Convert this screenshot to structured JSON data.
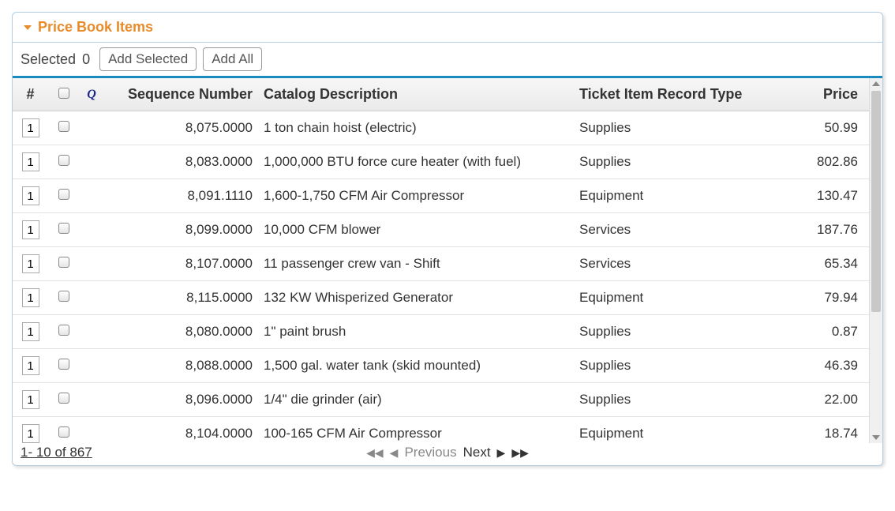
{
  "panel": {
    "title": "Price Book Items"
  },
  "toolbar": {
    "selected_label": "Selected",
    "selected_count": "0",
    "add_selected_label": "Add Selected",
    "add_all_label": "Add All"
  },
  "columns": {
    "num": "#",
    "q": "Q",
    "sequence": "Sequence Number",
    "description": "Catalog Description",
    "record_type": "Ticket Item Record Type",
    "price": "Price"
  },
  "rows": [
    {
      "qty": "1",
      "sequence": "8,075.0000",
      "description": "1 ton chain hoist (electric)",
      "record_type": "Supplies",
      "price": "50.99"
    },
    {
      "qty": "1",
      "sequence": "8,083.0000",
      "description": "1,000,000 BTU force cure heater (with fuel)",
      "record_type": "Supplies",
      "price": "802.86"
    },
    {
      "qty": "1",
      "sequence": "8,091.1110",
      "description": "1,600-1,750 CFM Air Compressor",
      "record_type": "Equipment",
      "price": "130.47"
    },
    {
      "qty": "1",
      "sequence": "8,099.0000",
      "description": "10,000 CFM blower",
      "record_type": "Services",
      "price": "187.76"
    },
    {
      "qty": "1",
      "sequence": "8,107.0000",
      "description": "11 passenger crew van - Shift",
      "record_type": "Services",
      "price": "65.34"
    },
    {
      "qty": "1",
      "sequence": "8,115.0000",
      "description": "132 KW Whisperized Generator",
      "record_type": "Equipment",
      "price": "79.94"
    },
    {
      "qty": "1",
      "sequence": "8,080.0000",
      "description": "1\" paint brush",
      "record_type": "Supplies",
      "price": "0.87"
    },
    {
      "qty": "1",
      "sequence": "8,088.0000",
      "description": "1,500 gal. water tank (skid mounted)",
      "record_type": "Supplies",
      "price": "46.39"
    },
    {
      "qty": "1",
      "sequence": "8,096.0000",
      "description": "1/4\" die grinder (air)",
      "record_type": "Supplies",
      "price": "22.00"
    },
    {
      "qty": "1",
      "sequence": "8,104.0000",
      "description": "100-165 CFM Air Compressor",
      "record_type": "Equipment",
      "price": "18.74"
    }
  ],
  "pager": {
    "range": "1- 10  of  867",
    "previous": "Previous",
    "next": "Next"
  }
}
